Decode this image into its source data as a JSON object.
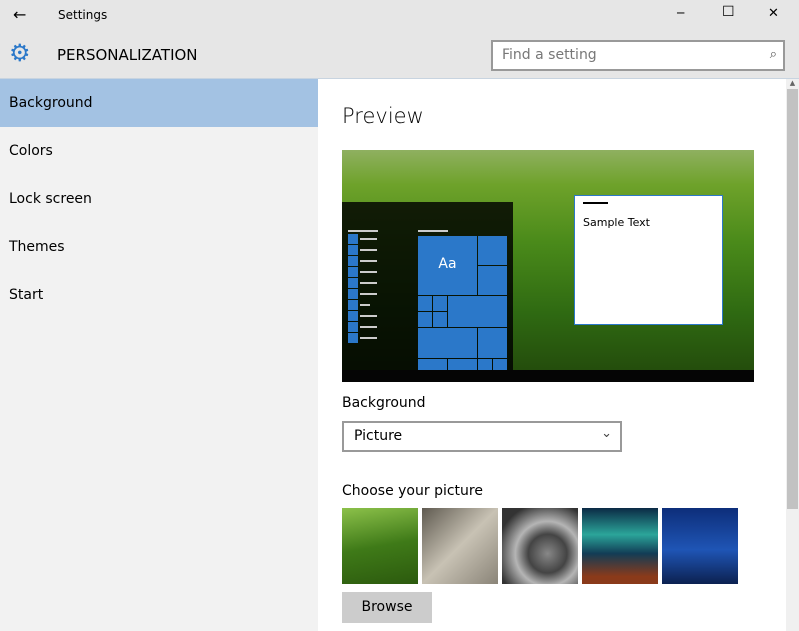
{
  "window": {
    "title": "Settings",
    "minimize": "─",
    "maximize": "☐",
    "close": "✕"
  },
  "header": {
    "title": "PERSONALIZATION",
    "search_placeholder": "Find a setting"
  },
  "sidebar": {
    "items": [
      {
        "label": "Background"
      },
      {
        "label": "Colors"
      },
      {
        "label": "Lock screen"
      },
      {
        "label": "Themes"
      },
      {
        "label": "Start"
      }
    ]
  },
  "main": {
    "preview_title": "Preview",
    "sample_text": "Sample Text",
    "tile_text": "Aa",
    "background_label": "Background",
    "background_value": "Picture",
    "choose_label": "Choose your picture",
    "browse_label": "Browse"
  },
  "colors": {
    "accent": "#2b78c9",
    "selected": "#a3c2e3"
  }
}
